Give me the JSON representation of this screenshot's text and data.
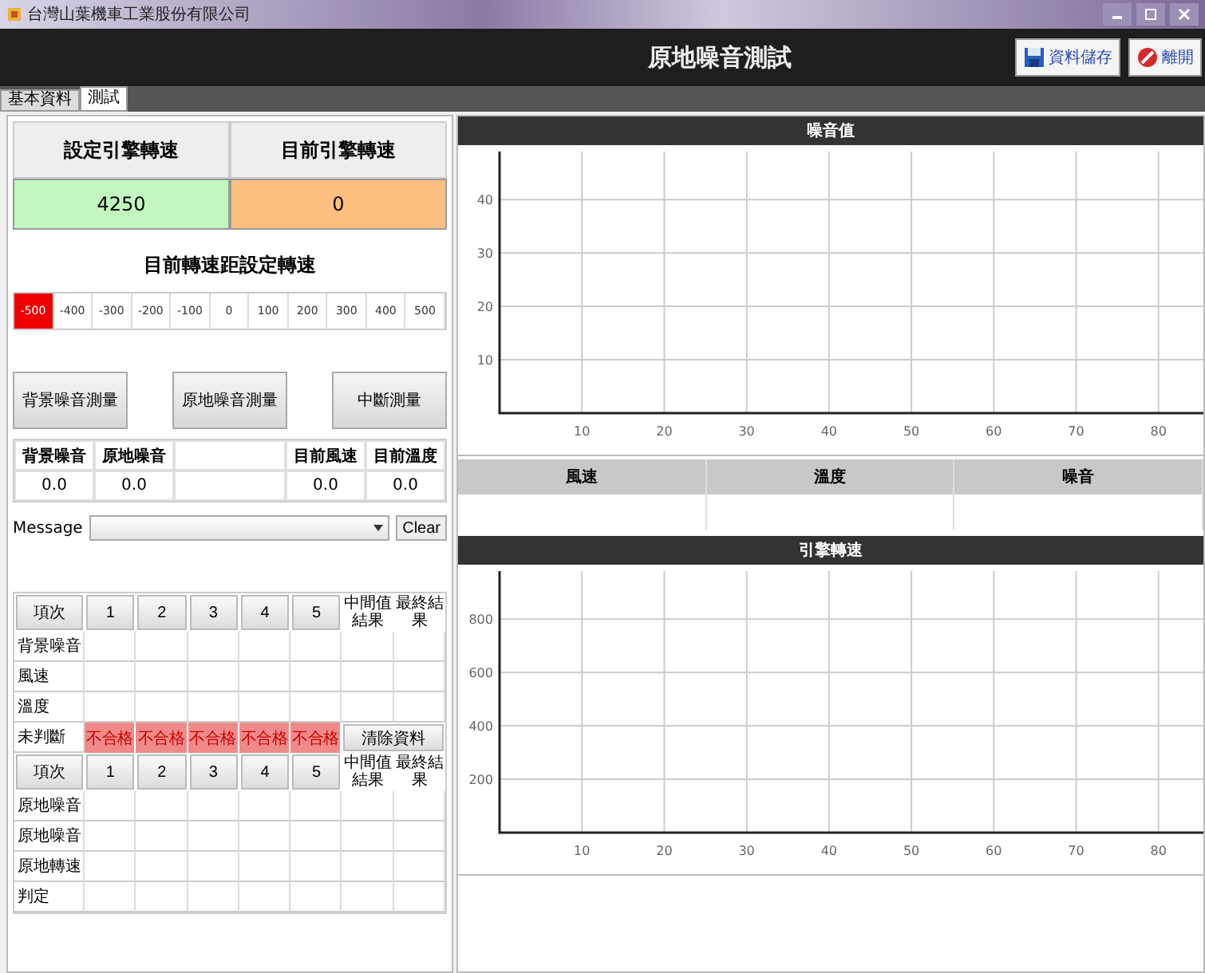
{
  "window": {
    "title": "台灣山葉機車工業股份有限公司"
  },
  "header": {
    "title": "原地噪音測試",
    "buttons": [
      {
        "label": "資料儲存",
        "kind": "save"
      },
      {
        "label": "離開",
        "kind": "exit"
      }
    ]
  },
  "tabs": [
    {
      "label": "基本資料",
      "selected": false
    },
    {
      "label": "測試",
      "selected": true
    }
  ],
  "rpm": {
    "set_label": "設定引擎轉速",
    "current_label": "目前引擎轉速",
    "set_value": "4250",
    "current_value": "0"
  },
  "deviation": {
    "title": "目前轉速距設定轉速",
    "scale": [
      {
        "label": "-500",
        "selected": true
      },
      {
        "label": "-400",
        "selected": false
      },
      {
        "label": "-300",
        "selected": false
      },
      {
        "label": "-200",
        "selected": false
      },
      {
        "label": "-100",
        "selected": false
      },
      {
        "label": "0",
        "selected": false
      },
      {
        "label": "100",
        "selected": false
      },
      {
        "label": "200",
        "selected": false
      },
      {
        "label": "300",
        "selected": false
      },
      {
        "label": "400",
        "selected": false
      },
      {
        "label": "500",
        "selected": false
      }
    ]
  },
  "actions": [
    "背景噪音測量",
    "原地噪音測量",
    "中斷測量"
  ],
  "readings": {
    "columns": [
      {
        "kind": "reading",
        "header": "背景噪音",
        "value": "0.0"
      },
      {
        "kind": "reading",
        "header": "原地噪音",
        "value": "0.0"
      },
      {
        "kind": "blank"
      },
      {
        "kind": "reading",
        "header": "目前風速",
        "value": "0.0"
      },
      {
        "kind": "reading",
        "header": "目前溫度",
        "value": "0.0"
      }
    ]
  },
  "message": {
    "label": "Message",
    "button": "Clear"
  },
  "grid": {
    "rows": [
      {
        "kind": "header",
        "cells": [
          "項次",
          "1",
          "2",
          "3",
          "4",
          "5",
          "中間值結果",
          "最終結果"
        ]
      },
      {
        "kind": "data",
        "label": "背景噪音"
      },
      {
        "kind": "data",
        "label": "風速"
      },
      {
        "kind": "data",
        "label": "溫度"
      },
      {
        "kind": "result",
        "label": "未判斷",
        "cells": [
          {
            "text": "不合格",
            "fail": true
          },
          {
            "text": "不合格",
            "fail": true
          },
          {
            "text": "不合格",
            "fail": true
          },
          {
            "text": "不合格",
            "fail": true
          },
          {
            "text": "不合格",
            "fail": true
          }
        ],
        "button": "清除資料"
      },
      {
        "kind": "header",
        "cells": [
          "項次",
          "1",
          "2",
          "3",
          "4",
          "5",
          "中間值結果",
          "最終結果"
        ]
      },
      {
        "kind": "data",
        "label": "原地噪音"
      },
      {
        "kind": "data",
        "label": "原地噪音"
      },
      {
        "kind": "data",
        "label": "原地轉速"
      },
      {
        "kind": "data",
        "label": "判定"
      }
    ]
  },
  "noise_chart": {
    "chart_data": {
      "type": "line",
      "title": "噪音值",
      "grid": true,
      "xlim": [
        0,
        87
      ],
      "ylim": [
        0,
        49
      ],
      "xticks": [
        10,
        20,
        30,
        40,
        50,
        60,
        70,
        80
      ],
      "yticks": [
        10,
        20,
        30,
        40
      ]
    }
  },
  "conditions": {
    "columns": [
      "風速",
      "溫度",
      "噪音"
    ]
  },
  "rpm_chart": {
    "chart_data": {
      "type": "line",
      "title": "引擎轉速",
      "grid": true,
      "xlim": [
        0,
        87
      ],
      "ylim": [
        0,
        980
      ],
      "xticks": [
        10,
        20,
        30,
        40,
        50,
        60,
        70,
        80
      ],
      "yticks": [
        200,
        400,
        600,
        800
      ]
    }
  }
}
